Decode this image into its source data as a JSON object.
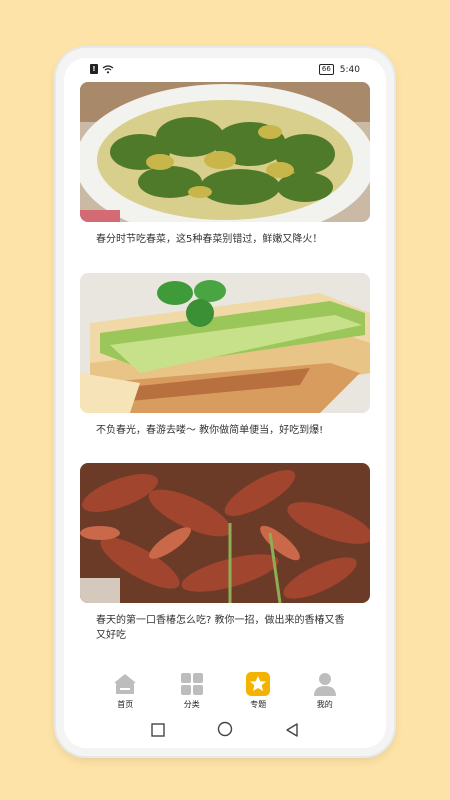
{
  "status_bar": {
    "battery": "66",
    "time": "5:40"
  },
  "articles": [
    {
      "title": "春分时节吃春菜，这5种春菜别错过，鲜嫩又降火！"
    },
    {
      "title": "不负春光，春游去喽～ 教你做简单便当，好吃到爆!"
    },
    {
      "title": "春天的第一口香椿怎么吃? 教你一招，做出来的香椿又香又好吃"
    }
  ],
  "tabs": [
    {
      "label": "首页",
      "icon": "home-icon"
    },
    {
      "label": "分类",
      "icon": "grid-icon"
    },
    {
      "label": "专题",
      "icon": "star-icon",
      "active": true
    },
    {
      "label": "我的",
      "icon": "user-icon"
    }
  ],
  "colors": {
    "accent": "#f5b301",
    "icon_gray": "#bdbdbd",
    "background": "#fde3a7"
  }
}
